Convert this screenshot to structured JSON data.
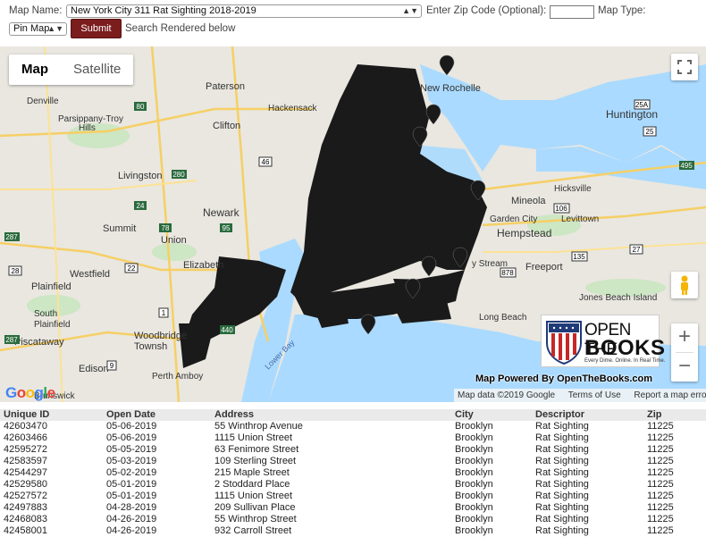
{
  "toolbar": {
    "map_name_label": "Map Name:",
    "map_name_value": "New York City 311 Rat Sighting 2018-2019",
    "zip_label": "Enter Zip Code (Optional):",
    "zip_value": "",
    "map_type_label": "Map Type:",
    "map_type_value": "Pin Map",
    "submit_label": "Submit",
    "status_text": "Search Rendered below"
  },
  "map": {
    "type_buttons": [
      "Map",
      "Satellite"
    ],
    "place_labels": [
      "Paterson",
      "New Rochelle",
      "Huntington",
      "Clifton",
      "Hackensack",
      "Newark",
      "Elizabeth",
      "Union",
      "Livingston",
      "Summit",
      "Westfield",
      "Plainfield",
      "Piscataway",
      "South Plainfield",
      "Woodbridge Township",
      "Edison",
      "New Brunswick",
      "Perth Amboy",
      "Parsippany-Troy Hills",
      "Denville",
      "Hempstead",
      "Mineola",
      "Garden City",
      "Levittown",
      "Hicksville",
      "Freeport",
      "Jones Beach Island",
      "Long Beach",
      "Valley Stream",
      "Lower Bay"
    ],
    "highway_labels": [
      "80",
      "287",
      "280",
      "78",
      "24",
      "95",
      "440",
      "9",
      "1",
      "25A",
      "25",
      "495",
      "106",
      "135",
      "878",
      "27",
      "22",
      "28",
      "46"
    ],
    "pin_color": "#1a1a1a",
    "google_logo": "Google",
    "zoom_in": "+",
    "zoom_out": "−",
    "brand": {
      "line1": "OPEN THE",
      "line2": "BOOKS",
      "tagline": "Every Dime. Online. In Real Time."
    },
    "powered_by": "Map Powered By OpenTheBooks.com",
    "attribution": [
      "Map data ©2019 Google",
      "Terms of Use",
      "Report a map error"
    ]
  },
  "table": {
    "headers": [
      "Unique ID",
      "Open Date",
      "Address",
      "City",
      "Descriptor",
      "Zip"
    ],
    "rows": [
      [
        "42603470",
        "05-06-2019",
        "55 Winthrop Avenue",
        "Brooklyn",
        "Rat Sighting",
        "11225"
      ],
      [
        "42603466",
        "05-06-2019",
        "1115 Union Street",
        "Brooklyn",
        "Rat Sighting",
        "11225"
      ],
      [
        "42595272",
        "05-05-2019",
        "63 Fenimore Street",
        "Brooklyn",
        "Rat Sighting",
        "11225"
      ],
      [
        "42583597",
        "05-03-2019",
        "109 Sterling Street",
        "Brooklyn",
        "Rat Sighting",
        "11225"
      ],
      [
        "42544297",
        "05-02-2019",
        "215 Maple Street",
        "Brooklyn",
        "Rat Sighting",
        "11225"
      ],
      [
        "42529580",
        "05-01-2019",
        "2 Stoddard Place",
        "Brooklyn",
        "Rat Sighting",
        "11225"
      ],
      [
        "42527572",
        "05-01-2019",
        "1115 Union Street",
        "Brooklyn",
        "Rat Sighting",
        "11225"
      ],
      [
        "42497883",
        "04-28-2019",
        "209 Sullivan Place",
        "Brooklyn",
        "Rat Sighting",
        "11225"
      ],
      [
        "42468083",
        "04-26-2019",
        "55 Winthrop Street",
        "Brooklyn",
        "Rat Sighting",
        "11225"
      ],
      [
        "42458001",
        "04-26-2019",
        "932 Carroll Street",
        "Brooklyn",
        "Rat Sighting",
        "11225"
      ]
    ]
  }
}
